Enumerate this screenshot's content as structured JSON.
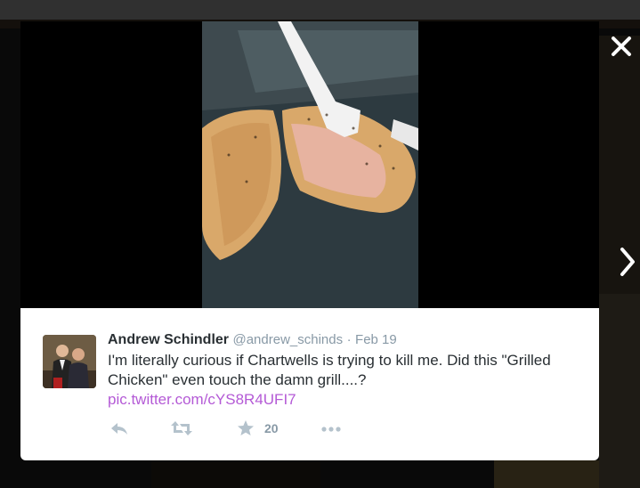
{
  "tweet": {
    "display_name": "Andrew Schindler",
    "handle": "@andrew_schinds",
    "separator": "·",
    "date": "Feb 19",
    "text": "I'm literally curious if Chartwells is trying to kill me. Did this \"Grilled Chicken\" even touch the damn grill....?",
    "link": "pic.twitter.com/cYS8R4UFI7",
    "favorite_count": "20"
  },
  "icons": {
    "close": "close-icon",
    "next": "chevron-right-icon",
    "reply": "reply-icon",
    "retweet": "retweet-icon",
    "favorite": "star-icon",
    "more": "more-dots-icon"
  },
  "colors": {
    "link": "#b45ad6",
    "muted": "#8899a6",
    "text": "#292f33"
  }
}
